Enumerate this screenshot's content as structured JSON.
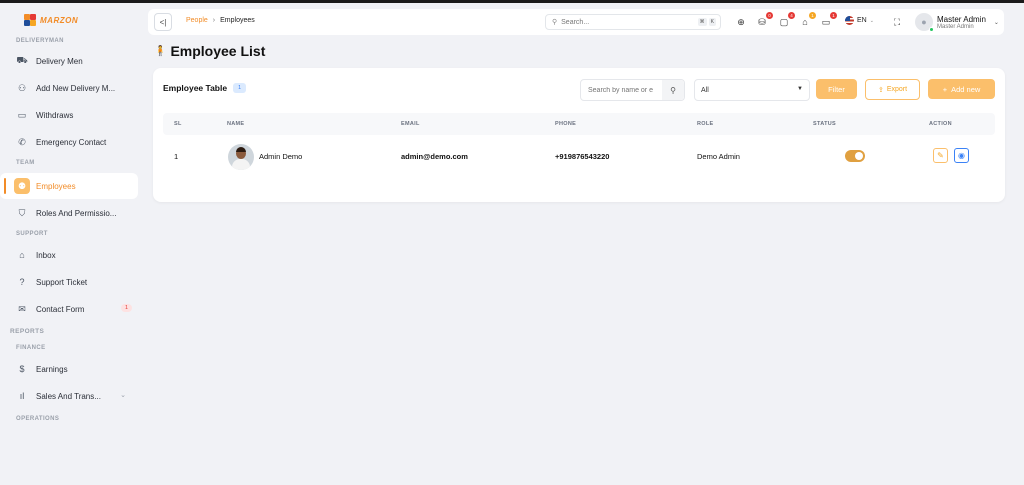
{
  "app": {
    "logo_text": "MARZON"
  },
  "sidebar": {
    "sections": [
      {
        "title": "DELIVERYMAN"
      },
      {
        "title": "TEAM"
      },
      {
        "title": "SUPPORT"
      },
      {
        "title": "REPORTS"
      },
      {
        "title": "FINANCE"
      },
      {
        "title": "OPERATIONS"
      }
    ],
    "items": [
      {
        "label": "Delivery Men",
        "icon": "truck-icon"
      },
      {
        "label": "Add New Delivery M...",
        "icon": "user-plus-icon"
      },
      {
        "label": "Withdraws",
        "icon": "card-icon"
      },
      {
        "label": "Emergency Contact",
        "icon": "phone-icon"
      },
      {
        "label": "Employees",
        "icon": "users-icon"
      },
      {
        "label": "Roles And Permissio...",
        "icon": "shield-icon"
      },
      {
        "label": "Inbox",
        "icon": "inbox-icon"
      },
      {
        "label": "Support Ticket",
        "icon": "help-icon"
      },
      {
        "label": "Contact Form",
        "icon": "mail-icon",
        "badge": "1"
      },
      {
        "label": "Earnings",
        "icon": "dollar-icon"
      },
      {
        "label": "Sales And Trans...",
        "icon": "bar-chart-icon"
      }
    ]
  },
  "header": {
    "breadcrumb": {
      "parent": "People",
      "separator": "›",
      "current": "Employees"
    },
    "search_placeholder": "Search...",
    "search_shortcut": [
      "⌘",
      "K"
    ],
    "badges": {
      "cart": "0",
      "messages": "4",
      "store": "1",
      "wallet": "1"
    },
    "language": "EN",
    "user": {
      "name": "Master Admin",
      "role": "Master Admin"
    }
  },
  "page": {
    "title": "Employee List"
  },
  "table": {
    "title": "Employee Table",
    "count": "1",
    "search_placeholder": "Search by name or e",
    "filter_value": "All",
    "filter_button": "Filter",
    "export_button": "Export",
    "add_button": "Add new",
    "columns": [
      "SL",
      "NAME",
      "EMAIL",
      "PHONE",
      "ROLE",
      "STATUS",
      "ACTION"
    ],
    "rows": [
      {
        "sl": "1",
        "name": "Admin Demo",
        "email": "admin@demo.com",
        "phone": "+919876543220",
        "role": "Demo Admin",
        "status_on": true
      }
    ]
  },
  "colors": {
    "accent": "#f28c28",
    "accent_light": "#fbbf6b",
    "info": "#3b82f6",
    "danger": "#e53935"
  }
}
